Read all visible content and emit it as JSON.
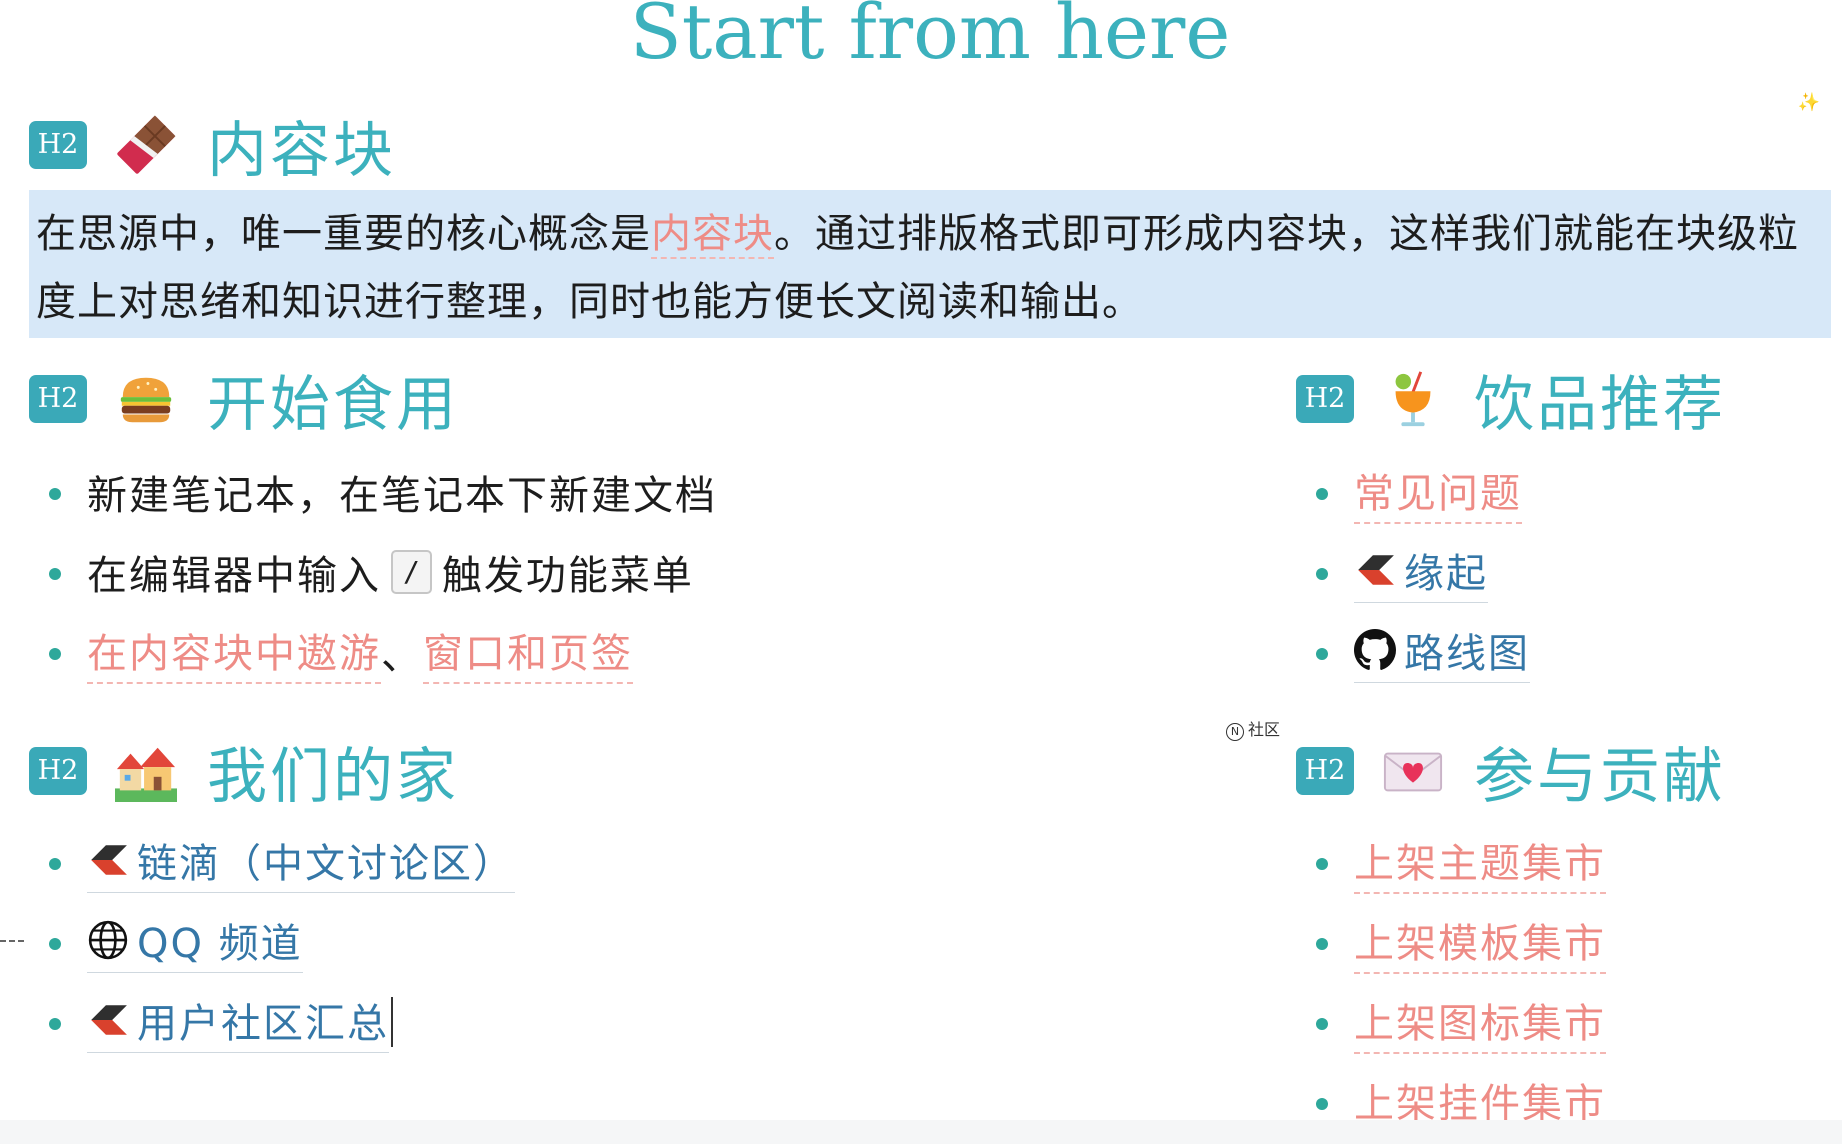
{
  "page": {
    "title": "Start from here"
  },
  "badge": "H2",
  "sections": {
    "content_block": {
      "heading": "内容块"
    },
    "getting_started": {
      "heading": "开始食用"
    },
    "drinks": {
      "heading": "饮品推荐"
    },
    "home": {
      "heading": "我们的家"
    },
    "contribute": {
      "heading": "参与贡献"
    }
  },
  "callout": {
    "part1": "在思源中，唯一重要的核心概念是",
    "ref": "内容块",
    "part2": "。通过排版格式即可形成内容块，这样我们就能在块级粒度上对思绪和知识进行整理，同时也能方便长文阅读和输出。"
  },
  "getting_started_items": {
    "item1": "新建笔记本，在笔记本下新建文档",
    "item2_before": "在编辑器中输入",
    "item2_key": "/",
    "item2_after": "触发功能菜单",
    "item3_ref1": "在内容块中遨游",
    "item3_sep": "、",
    "item3_ref2": "窗口和页签"
  },
  "drinks_items": {
    "faq": "常见问题",
    "origin": "缘起",
    "roadmap": "路线图"
  },
  "home_items": {
    "ld246": "链滴（中文讨论区）",
    "qq": "QQ 频道",
    "community": "用户社区汇总"
  },
  "contribute_items": {
    "theme": "上架主题集市",
    "template": "上架模板集市",
    "icon": "上架图标集市",
    "widget": "上架挂件集市"
  },
  "tag_note": {
    "badge": "N",
    "text": "社区"
  },
  "icons": {
    "sparkle": "sparkles-icon",
    "content_block": "chocolate-bar-icon",
    "getting_started": "hamburger-icon",
    "drinks": "tropical-drink-icon",
    "home": "houses-icon",
    "contribute": "love-letter-icon",
    "siyuan": "siyuan-logo-icon",
    "github": "github-icon",
    "globe": "globe-icon"
  },
  "colors": {
    "heading": "#3cb1bd",
    "badge": "#3aa9b8",
    "callout_bg": "#d7e8f8",
    "ref": "#ee8c86",
    "link": "#3577a7",
    "bullet": "#2ea89b"
  }
}
